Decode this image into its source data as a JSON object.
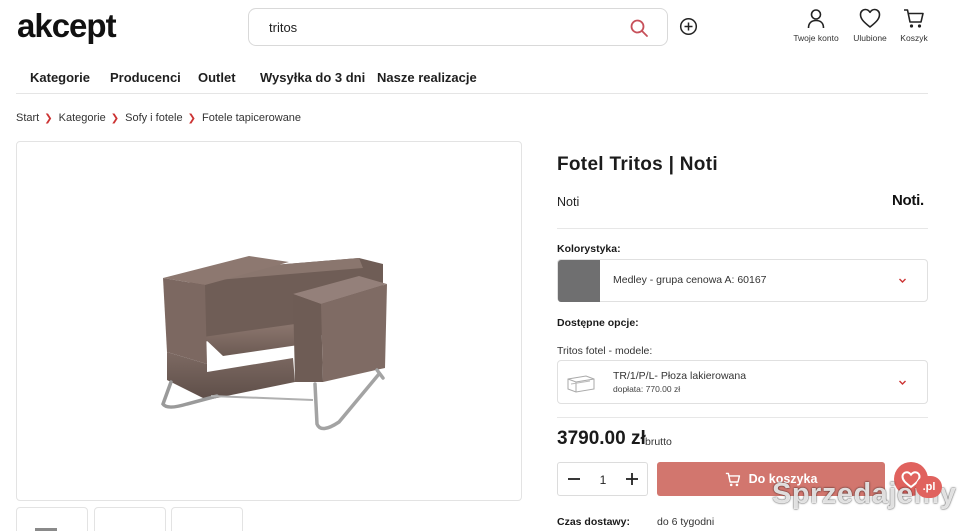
{
  "header": {
    "logo_text": "akcept",
    "search": {
      "value": "tritos",
      "placeholder": ""
    },
    "account_label": "Twoje konto",
    "favorites_label": "Ulubione",
    "cart_label": "Koszyk"
  },
  "nav": {
    "items": [
      {
        "label": "Kategorie"
      },
      {
        "label": "Producenci"
      },
      {
        "label": "Outlet"
      },
      {
        "label": "Wysyłka do 3 dni"
      },
      {
        "label": "Nasze realizacje"
      }
    ]
  },
  "breadcrumb": [
    "Start",
    "Kategorie",
    "Sofy i fotele",
    "Fotele tapicerowane"
  ],
  "product": {
    "title": "Fotel Tritos | Noti",
    "brand": "Noti",
    "brand_logo": "Noti.",
    "colors_label": "Kolorystyka:",
    "color_value": "Medley - grupa cenowa A: 60167",
    "options_label": "Dostępne opcje:",
    "model_label": "Tritos fotel - modele:",
    "model_value": "TR/1/P/L- Płoza lakierowana",
    "model_surcharge": "dopłata: 770.00 zł",
    "price": "3790.00 zł",
    "price_suffix": "brutto",
    "quantity": "1",
    "add_to_cart": "Do koszyka",
    "delivery_label": "Czas dostawy:",
    "delivery_value": "do 6 tygodni"
  },
  "watermark": {
    "text": "Sprzedajemy",
    "suffix": ".pl"
  },
  "colors": {
    "accent": "#d2766e",
    "breadcrumb_sep": "#cc3333",
    "swatch": "#6f6f70",
    "leather": "#7a6760"
  }
}
